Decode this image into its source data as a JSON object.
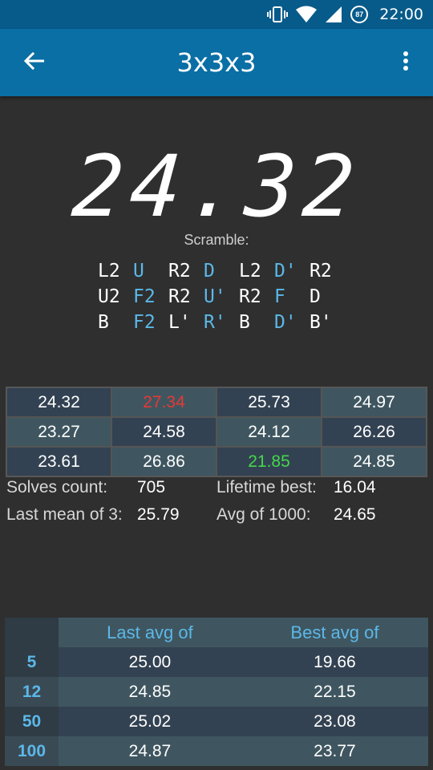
{
  "status_bar": {
    "time": "22:00",
    "battery": "87",
    "icons": [
      "vibrate-icon",
      "wifi-icon",
      "signal-icon",
      "battery-icon"
    ]
  },
  "app_bar": {
    "title": "3x3x3",
    "back_icon": "arrow-left-icon",
    "menu_icon": "more-vertical-icon"
  },
  "timer": {
    "value": "24.32"
  },
  "scramble": {
    "label": "Scramble:",
    "rows": [
      [
        {
          "m": "L2",
          "c": "white"
        },
        {
          "m": "U",
          "c": "blue"
        },
        {
          "m": "R2",
          "c": "white"
        },
        {
          "m": "D",
          "c": "blue"
        },
        {
          "m": "L2",
          "c": "white"
        },
        {
          "m": "D'",
          "c": "blue"
        },
        {
          "m": "R2",
          "c": "white"
        }
      ],
      [
        {
          "m": "U2",
          "c": "white"
        },
        {
          "m": "F2",
          "c": "blue"
        },
        {
          "m": "R2",
          "c": "white"
        },
        {
          "m": "U'",
          "c": "blue"
        },
        {
          "m": "R2",
          "c": "white"
        },
        {
          "m": "F",
          "c": "blue"
        },
        {
          "m": "D",
          "c": "white"
        }
      ],
      [
        {
          "m": "B",
          "c": "white"
        },
        {
          "m": "F2",
          "c": "blue"
        },
        {
          "m": "L'",
          "c": "white"
        },
        {
          "m": "R'",
          "c": "blue"
        },
        {
          "m": "B",
          "c": "white"
        },
        {
          "m": "D'",
          "c": "blue"
        },
        {
          "m": "B'",
          "c": "white"
        }
      ]
    ]
  },
  "solves": [
    [
      {
        "v": "24.32",
        "s": "dark"
      },
      {
        "v": "27.34",
        "s": "light",
        "f": "worst"
      },
      {
        "v": "25.73",
        "s": "dark"
      },
      {
        "v": "24.97",
        "s": "light"
      }
    ],
    [
      {
        "v": "23.27",
        "s": "light"
      },
      {
        "v": "24.58",
        "s": "dark"
      },
      {
        "v": "24.12",
        "s": "light"
      },
      {
        "v": "26.26",
        "s": "dark"
      }
    ],
    [
      {
        "v": "23.61",
        "s": "dark"
      },
      {
        "v": "26.86",
        "s": "light"
      },
      {
        "v": "21.85",
        "s": "dark",
        "f": "best"
      },
      {
        "v": "24.85",
        "s": "light"
      }
    ]
  ],
  "stats": {
    "solves_count_label": "Solves count:",
    "solves_count": "705",
    "lifetime_best_label": "Lifetime best:",
    "lifetime_best": "16.04",
    "last_mean_label": "Last mean of 3:",
    "last_mean": "25.79",
    "avg1000_label": "Avg of 1000:",
    "avg1000": "24.65"
  },
  "averages": {
    "headers": [
      "Last avg of",
      "Best avg of"
    ],
    "rows": [
      {
        "n": "5",
        "last": "25.00",
        "best": "19.66"
      },
      {
        "n": "12",
        "last": "24.85",
        "best": "22.15"
      },
      {
        "n": "50",
        "last": "25.02",
        "best": "23.08"
      },
      {
        "n": "100",
        "last": "24.87",
        "best": "23.77"
      }
    ]
  },
  "colors": {
    "primary": "#0a6fa5",
    "primary_dark": "#075b8a",
    "accent": "#5bb8e8",
    "worst": "#e53935",
    "best": "#43d84a",
    "background": "#2f2f2f"
  }
}
